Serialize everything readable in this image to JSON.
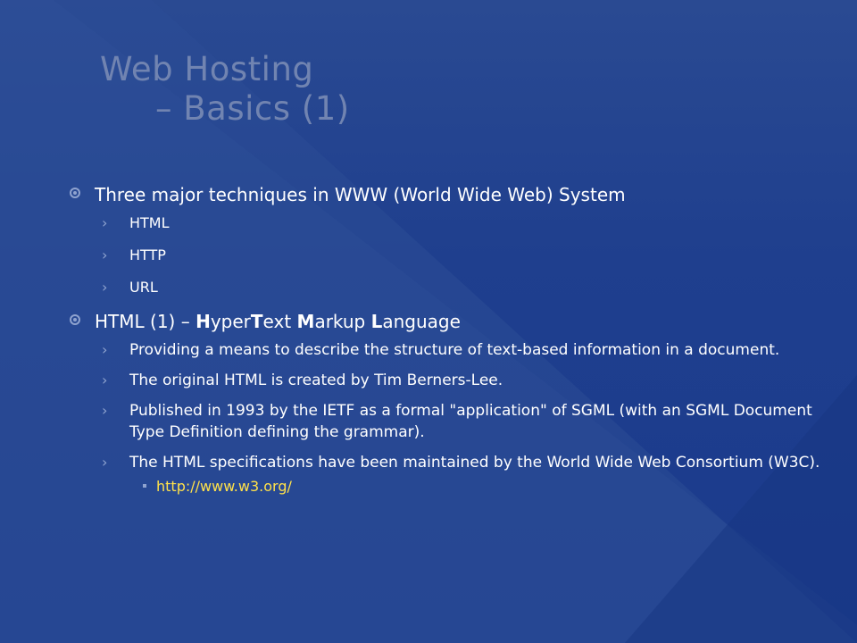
{
  "title": {
    "line1": "Web Hosting",
    "line2": "– Basics (1)"
  },
  "bullets": [
    {
      "text": "Three major techniques in WWW (World Wide Web) System",
      "subs": [
        "HTML",
        "HTTP",
        "URL"
      ]
    },
    {
      "text_prefix": "HTML (1) – ",
      "acronym_parts": [
        {
          "bold": "H",
          "rest": "yper"
        },
        {
          "bold": "T",
          "rest": "ext "
        },
        {
          "bold": "M",
          "rest": "arkup "
        },
        {
          "bold": "L",
          "rest": "anguage"
        }
      ],
      "subs": [
        "Providing a means to describe the structure of text-based information in a document.",
        "The original HTML is created by Tim Berners-Lee.",
        "Published in 1993 by the IETF as a formal \"application\" of SGML (with an SGML Document Type Definition defining the grammar).",
        "The HTML specifications have been maintained by the World Wide Web Consortium (W3C)."
      ],
      "link": "http://www.w3.org/"
    }
  ],
  "colors": {
    "background": "#1f3f8e",
    "title": "#7184b1",
    "text": "#ffffff",
    "link": "#ffe14a",
    "bullet": "#8fa3cf"
  },
  "icons": {
    "level1": "circle-bullet-icon",
    "level2": "chevron-right-icon",
    "level3": "square-bullet-icon"
  }
}
